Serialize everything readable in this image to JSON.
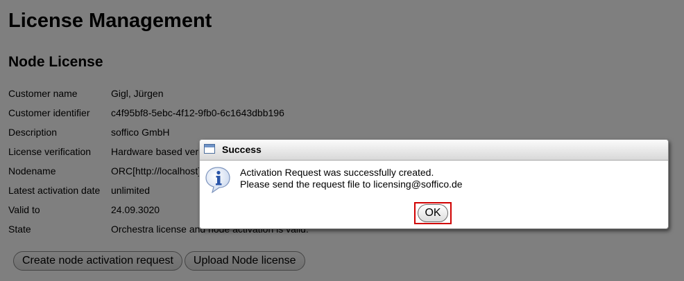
{
  "page": {
    "title": "License Management",
    "section_title": "Node License"
  },
  "license_info": [
    {
      "label": "Customer name",
      "value": "Gigl, Jürgen"
    },
    {
      "label": "Customer identifier",
      "value": "c4f95bf8-5ebc-4f12-9fb0-6c1643dbb196"
    },
    {
      "label": "Description",
      "value": "soffico GmbH"
    },
    {
      "label": "License verification",
      "value": "Hardware based verification"
    },
    {
      "label": "Nodename",
      "value": "ORC[http://localhost]"
    },
    {
      "label": "Latest activation date",
      "value": "unlimited"
    },
    {
      "label": "Valid to",
      "value": "24.09.3020"
    },
    {
      "label": "State",
      "value": "Orchestra license and node activation is valid."
    }
  ],
  "actions": {
    "create_activation_request": "Create node activation request",
    "upload_node_license": "Upload Node license"
  },
  "dialog": {
    "title": "Success",
    "message_line1": "Activation Request was successfully created.",
    "message_line2": "Please send the request file to licensing@soffico.de",
    "ok_label": "OK",
    "icon": "info-icon"
  },
  "colors": {
    "highlight_border": "#d00000",
    "overlay": "rgba(0,0,0,0.5)"
  }
}
